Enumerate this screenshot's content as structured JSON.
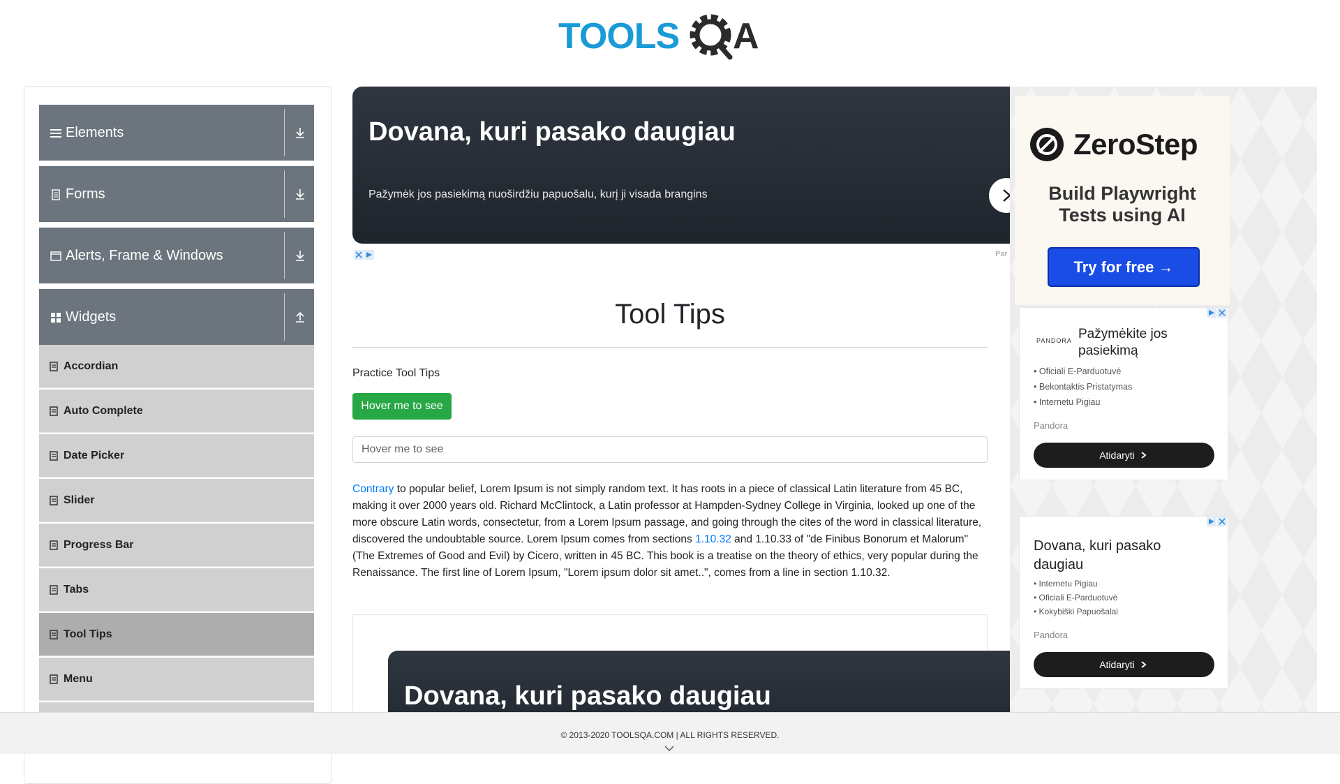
{
  "header": {
    "logo_text_left": "TOOLS",
    "logo_text_right": "A"
  },
  "sidebar": {
    "groups": [
      {
        "label": "Elements",
        "icon": "menu-icon",
        "expanded": false
      },
      {
        "label": "Forms",
        "icon": "document-icon",
        "expanded": false
      },
      {
        "label": "Alerts, Frame & Windows",
        "icon": "window-icon",
        "expanded": false
      },
      {
        "label": "Widgets",
        "icon": "grid-icon",
        "expanded": true
      }
    ],
    "widget_items": [
      {
        "label": "Accordian",
        "active": false
      },
      {
        "label": "Auto Complete",
        "active": false
      },
      {
        "label": "Date Picker",
        "active": false
      },
      {
        "label": "Slider",
        "active": false
      },
      {
        "label": "Progress Bar",
        "active": false
      },
      {
        "label": "Tabs",
        "active": false
      },
      {
        "label": "Tool Tips",
        "active": true
      },
      {
        "label": "Menu",
        "active": false
      }
    ]
  },
  "top_banner": {
    "title": "Dovana, kuri pasako daugiau",
    "subtitle": "Pažymėk jos pasiekimą nuoširdžiu papuošalu, kurį ji visada brangins",
    "cut_text": "Par"
  },
  "main": {
    "title": "Tool Tips",
    "practice_label": "Practice Tool Tips",
    "hover_button_label": "Hover me to see",
    "hover_input_placeholder": "Hover me to see",
    "paragraph": {
      "link1": "Contrary",
      "text1": " to popular belief, Lorem Ipsum is not simply random text. It has roots in a piece of classical Latin literature from 45 BC, making it over 2000 years old. Richard McClintock, a Latin professor at Hampden-Sydney College in Virginia, looked up one of the more obscure Latin words, consectetur, from a Lorem Ipsum passage, and going through the cites of the word in classical literature, discovered the undoubtable source. Lorem Ipsum comes from sections ",
      "link2": "1.10.32",
      "text2": " and 1.10.33 of \"de Finibus Bonorum et Malorum\" (The Extremes of Good and Evil) by Cicero, written in 45 BC. This book is a treatise on the theory of ethics, very popular during the Renaissance. The first line of Lorem Ipsum, \"Lorem ipsum dolor sit amet..\", comes from a line in section 1.10.32."
    }
  },
  "bottom_banner": {
    "title": "Dovana, kuri pasako daugiau"
  },
  "right_ads": {
    "zerostep": {
      "brand": "ZeroStep",
      "headline_line1": "Build Playwright",
      "headline_line2": "Tests using AI",
      "cta": "Try for free →"
    },
    "ad_a": {
      "logo": "PANDORA",
      "title": "Pažymėkite jos pasiekimą",
      "bullets": [
        "Oficiali E-Parduotuvė",
        "Bekontaktis Pristatymas",
        "Internetu Pigiau"
      ],
      "brand": "Pandora",
      "button": "Atidaryti"
    },
    "ad_b": {
      "title": "Dovana, kuri pasako daugiau",
      "bullets": [
        "Internetu Pigiau",
        "Oficiali E-Parduotuvė",
        "Kokybiški Papuošalai"
      ],
      "brand": "Pandora",
      "button": "Atidaryti"
    }
  },
  "footer": {
    "text": "© 2013-2020 TOOLSQA.COM | ALL RIGHTS RESERVED."
  },
  "colors": {
    "accent": "#1a9bd7",
    "sidebar_group": "#6c757d",
    "sidebar_item": "#d0d0d0",
    "sidebar_active": "#adadad",
    "success": "#28a745",
    "link": "#007bff"
  }
}
